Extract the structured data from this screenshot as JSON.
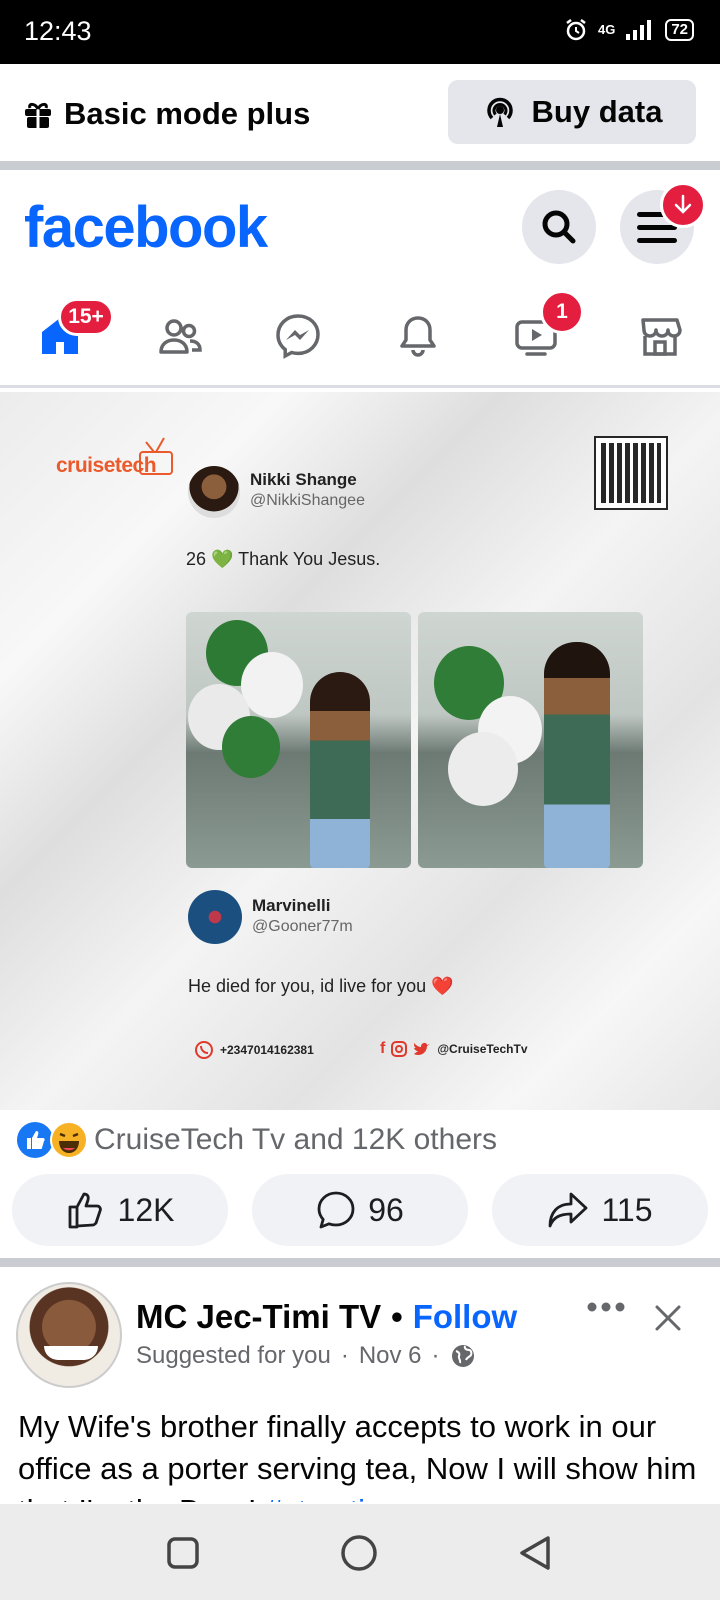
{
  "status_bar": {
    "time": "12:43",
    "network": "4G",
    "battery": "72"
  },
  "mode_bar": {
    "mode_label": "Basic mode plus",
    "buy_data_label": "Buy data"
  },
  "header": {
    "logo": "facebook",
    "menu_badge": "↓"
  },
  "nav": {
    "tabs": [
      {
        "name": "home",
        "badge": "15+"
      },
      {
        "name": "friends",
        "badge": ""
      },
      {
        "name": "messenger",
        "badge": ""
      },
      {
        "name": "notifications",
        "badge": ""
      },
      {
        "name": "video",
        "badge": "1"
      },
      {
        "name": "marketplace",
        "badge": ""
      }
    ]
  },
  "post1": {
    "image": {
      "brand": "cruisetech",
      "tweet1": {
        "name": "Nikki Shange",
        "handle": "@NikkiShangee",
        "text": "26 💚 Thank You Jesus."
      },
      "tweet2": {
        "name": "Marvinelli",
        "handle": "@Gooner77m",
        "text": "He died for you, id live for you ❤️"
      },
      "phone": "+2347014162381",
      "social_handle": "@CruiseTechTv"
    },
    "reactions_text": "CruiseTech Tv and 12K others",
    "likes": "12K",
    "comments": "96",
    "shares": "115"
  },
  "post2": {
    "author": "MC Jec-Timi TV",
    "follow_label": "Follow",
    "suggested": "Suggested for you",
    "date": "Nov 6",
    "text": "My Wife's brother finally accepts  to work in our office as a porter serving tea, Now I will show him that I'm the Boss! ",
    "hashtag": "#storytime"
  },
  "colors": {
    "brand_blue": "#0866ff",
    "badge_red": "#e41e3f",
    "cruisetech_orange": "#ea5a2a"
  }
}
